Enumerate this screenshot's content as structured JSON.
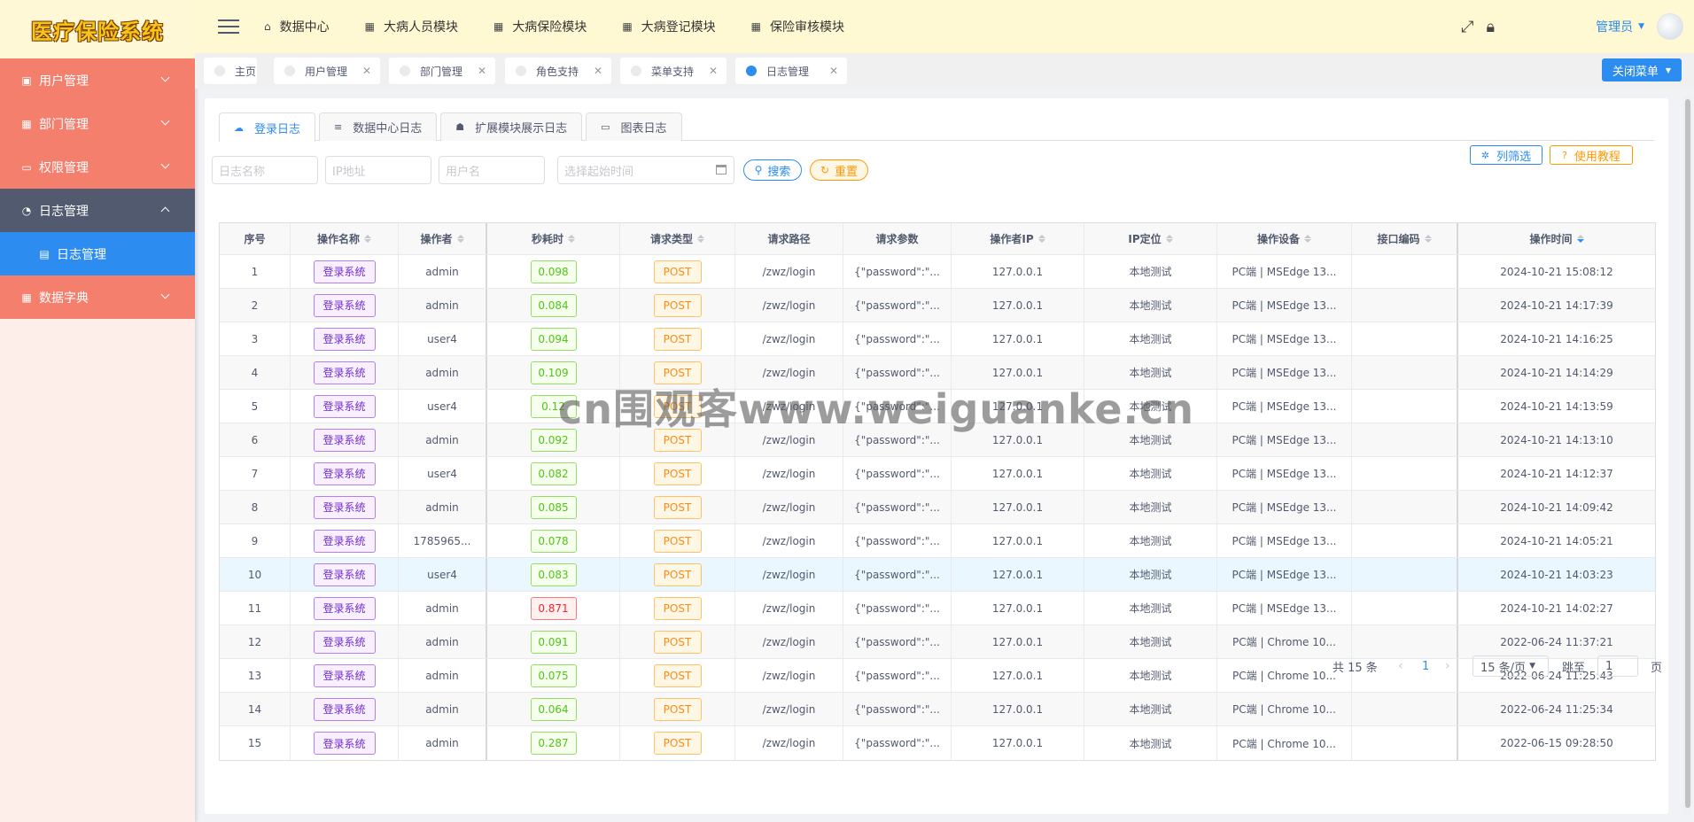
{
  "logo": {
    "text": "医疗保险系统"
  },
  "sidebar": {
    "items": [
      {
        "label": "用户管理",
        "icon": "user-icon",
        "glyph": "▣"
      },
      {
        "label": "部门管理",
        "icon": "grid-icon",
        "glyph": "▦"
      },
      {
        "label": "权限管理",
        "icon": "monitor-icon",
        "glyph": "▭"
      },
      {
        "label": "日志管理",
        "icon": "pie-icon",
        "glyph": "◔"
      },
      {
        "label": "日志管理",
        "icon": "document-icon",
        "glyph": "▤"
      },
      {
        "label": "数据字典",
        "icon": "grid-icon",
        "glyph": "▦"
      }
    ]
  },
  "header": {
    "nav": [
      {
        "label": "数据中心",
        "glyph": "⌂"
      },
      {
        "label": "大病人员模块",
        "glyph": "▦"
      },
      {
        "label": "大病保险模块",
        "glyph": "▦"
      },
      {
        "label": "大病登记模块",
        "glyph": "▦"
      },
      {
        "label": "保险审核模块",
        "glyph": "▦"
      }
    ],
    "user": "管理员"
  },
  "tags": [
    {
      "label": "主页"
    },
    {
      "label": "用户管理"
    },
    {
      "label": "部门管理"
    },
    {
      "label": "角色支持"
    },
    {
      "label": "菜单支持"
    },
    {
      "label": "日志管理"
    }
  ],
  "close_menu_label": "关闭菜单",
  "tabs": [
    {
      "label": "登录日志",
      "icon": "cloud-icon",
      "glyph": "☁"
    },
    {
      "label": "数据中心日志",
      "icon": "list-icon",
      "glyph": "≡"
    },
    {
      "label": "扩展模块展示日志",
      "icon": "user-group-icon",
      "glyph": "☗"
    },
    {
      "label": "图表日志",
      "icon": "laptop-icon",
      "glyph": "▭"
    }
  ],
  "filters": {
    "log_name": "日志名称",
    "ip": "IP地址",
    "username": "用户名",
    "date_range": "选择起始时间"
  },
  "buttons": {
    "search": "搜索",
    "reset": "重置",
    "columns": "列筛选",
    "help": "使用教程"
  },
  "table": {
    "columns": [
      "序号",
      "操作名称",
      "操作者",
      "秒耗时",
      "请求类型",
      "请求路径",
      "请求参数",
      "操作者IP",
      "IP定位",
      "操作设备",
      "接口编码",
      "操作时间"
    ],
    "rows": [
      [
        "1",
        "登录系统",
        "admin",
        "0.098",
        "POST",
        "/zwz/login",
        "{\"password\":\"...",
        "127.0.0.1",
        "本地测试",
        "PC端 | MSEdge 13...",
        "",
        "2024-10-21 15:08:12"
      ],
      [
        "2",
        "登录系统",
        "admin",
        "0.084",
        "POST",
        "/zwz/login",
        "{\"password\":\"...",
        "127.0.0.1",
        "本地测试",
        "PC端 | MSEdge 13...",
        "",
        "2024-10-21 14:17:39"
      ],
      [
        "3",
        "登录系统",
        "user4",
        "0.094",
        "POST",
        "/zwz/login",
        "{\"password\":\"...",
        "127.0.0.1",
        "本地测试",
        "PC端 | MSEdge 13...",
        "",
        "2024-10-21 14:16:25"
      ],
      [
        "4",
        "登录系统",
        "admin",
        "0.109",
        "POST",
        "/zwz/login",
        "{\"password\":\"...",
        "127.0.0.1",
        "本地测试",
        "PC端 | MSEdge 13...",
        "",
        "2024-10-21 14:14:29"
      ],
      [
        "5",
        "登录系统",
        "user4",
        "0.12",
        "POST",
        "/zwz/login",
        "{\"password\":\"...",
        "127.0.0.1",
        "本地测试",
        "PC端 | MSEdge 13...",
        "",
        "2024-10-21 14:13:59"
      ],
      [
        "6",
        "登录系统",
        "admin",
        "0.092",
        "POST",
        "/zwz/login",
        "{\"password\":\"...",
        "127.0.0.1",
        "本地测试",
        "PC端 | MSEdge 13...",
        "",
        "2024-10-21 14:13:10"
      ],
      [
        "7",
        "登录系统",
        "user4",
        "0.082",
        "POST",
        "/zwz/login",
        "{\"password\":\"...",
        "127.0.0.1",
        "本地测试",
        "PC端 | MSEdge 13...",
        "",
        "2024-10-21 14:12:37"
      ],
      [
        "8",
        "登录系统",
        "admin",
        "0.085",
        "POST",
        "/zwz/login",
        "{\"password\":\"...",
        "127.0.0.1",
        "本地测试",
        "PC端 | MSEdge 13...",
        "",
        "2024-10-21 14:09:42"
      ],
      [
        "9",
        "登录系统",
        "1785965...",
        "0.078",
        "POST",
        "/zwz/login",
        "{\"password\":\"...",
        "127.0.0.1",
        "本地测试",
        "PC端 | MSEdge 13...",
        "",
        "2024-10-21 14:05:21"
      ],
      [
        "10",
        "登录系统",
        "user4",
        "0.083",
        "POST",
        "/zwz/login",
        "{\"password\":\"...",
        "127.0.0.1",
        "本地测试",
        "PC端 | MSEdge 13...",
        "",
        "2024-10-21 14:03:23"
      ],
      [
        "11",
        "登录系统",
        "admin",
        "0.871",
        "POST",
        "/zwz/login",
        "{\"password\":\"...",
        "127.0.0.1",
        "本地测试",
        "PC端 | MSEdge 13...",
        "",
        "2024-10-21 14:02:27"
      ],
      [
        "12",
        "登录系统",
        "admin",
        "0.091",
        "POST",
        "/zwz/login",
        "{\"password\":\"...",
        "127.0.0.1",
        "本地测试",
        "PC端 | Chrome 10...",
        "",
        "2022-06-24 11:37:21"
      ],
      [
        "13",
        "登录系统",
        "admin",
        "0.075",
        "POST",
        "/zwz/login",
        "{\"password\":\"...",
        "127.0.0.1",
        "本地测试",
        "PC端 | Chrome 10...",
        "",
        "2022-06-24 11:25:43"
      ],
      [
        "14",
        "登录系统",
        "admin",
        "0.064",
        "POST",
        "/zwz/login",
        "{\"password\":\"...",
        "127.0.0.1",
        "本地测试",
        "PC端 | Chrome 10...",
        "",
        "2022-06-24 11:25:34"
      ],
      [
        "15",
        "登录系统",
        "admin",
        "0.287",
        "POST",
        "/zwz/login",
        "{\"password\":\"...",
        "127.0.0.1",
        "本地测试",
        "PC端 | Chrome 10...",
        "",
        "2022-06-15 09:28:50"
      ]
    ],
    "slow_threshold": 0.5
  },
  "pagination": {
    "total": "共 15 条",
    "current": "1",
    "page_size": "15 条/页",
    "jump_label": "跳至",
    "jump_value": "1",
    "unit": "页"
  },
  "watermark": "cn围观客www.weiguanke.cn",
  "colors": {
    "accent": "#2d8cf0",
    "sidebar_coral": "#f47f6d",
    "header_bg": "#fff9d3"
  }
}
